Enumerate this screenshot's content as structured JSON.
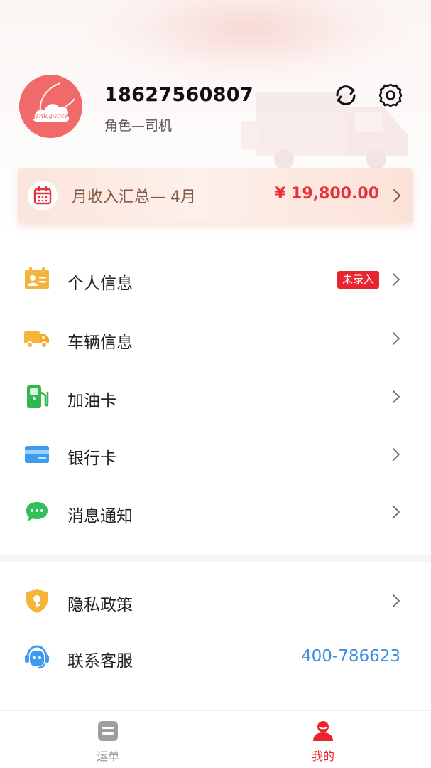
{
  "header": {
    "phone": "18627560807",
    "role": "角色—司机",
    "avatar_text": "Trilogistics"
  },
  "income": {
    "label": "月收入汇总— 4月",
    "amount": "¥ 19,800.00"
  },
  "menu": {
    "personal": {
      "label": "个人信息",
      "badge": "未录入"
    },
    "vehicle": {
      "label": "车辆信息"
    },
    "fuel": {
      "label": "加油卡"
    },
    "bank": {
      "label": "银行卡"
    },
    "message": {
      "label": "消息通知"
    },
    "privacy": {
      "label": "隐私政策"
    },
    "service": {
      "label": "联系客服",
      "hotline": "400-786623"
    }
  },
  "tabbar": {
    "waybill": "运单",
    "mine": "我的"
  },
  "colors": {
    "accent": "#e8242e",
    "link": "#3b8ee0",
    "avatar": "#f06a6a"
  }
}
